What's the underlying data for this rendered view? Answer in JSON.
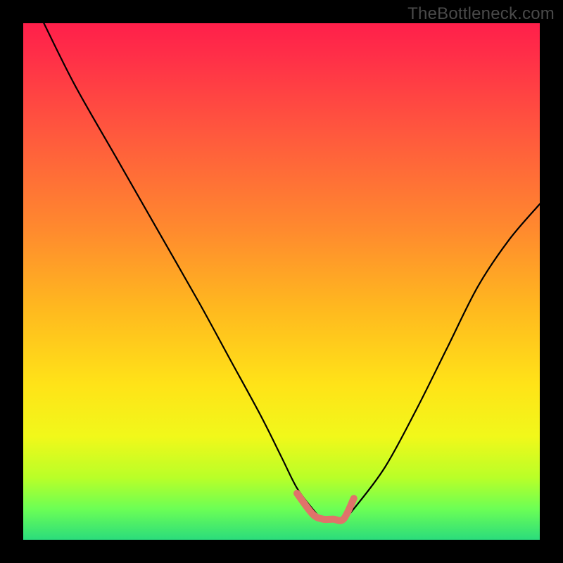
{
  "watermark": "TheBottleneck.com",
  "chart_data": {
    "type": "line",
    "title": "",
    "xlabel": "",
    "ylabel": "",
    "xlim": [
      0,
      100
    ],
    "ylim": [
      0,
      100
    ],
    "grid": false,
    "legend": false,
    "annotations": [],
    "series": [
      {
        "name": "curve",
        "color": "#000000",
        "x": [
          4,
          10,
          18,
          26,
          34,
          40,
          46,
          50,
          53,
          56,
          58,
          60,
          62,
          64,
          70,
          76,
          82,
          88,
          94,
          100
        ],
        "y": [
          100,
          88,
          74,
          60,
          46,
          35,
          24,
          16,
          10,
          6,
          4,
          4,
          4,
          6,
          14,
          25,
          37,
          49,
          58,
          65
        ]
      },
      {
        "name": "base-mark",
        "color": "#e0736a",
        "x": [
          53,
          56,
          58,
          60,
          62,
          64
        ],
        "y": [
          9,
          5,
          4,
          4,
          4,
          8
        ]
      }
    ],
    "gradient_stops": [
      {
        "pos": 0,
        "color": "#ff1f4a"
      },
      {
        "pos": 6,
        "color": "#ff2e48"
      },
      {
        "pos": 22,
        "color": "#ff5a3d"
      },
      {
        "pos": 40,
        "color": "#ff8a2e"
      },
      {
        "pos": 55,
        "color": "#ffb81f"
      },
      {
        "pos": 70,
        "color": "#ffe318"
      },
      {
        "pos": 80,
        "color": "#f1f81a"
      },
      {
        "pos": 88,
        "color": "#b9ff28"
      },
      {
        "pos": 94,
        "color": "#6cff55"
      },
      {
        "pos": 100,
        "color": "#2bdc7c"
      }
    ]
  }
}
